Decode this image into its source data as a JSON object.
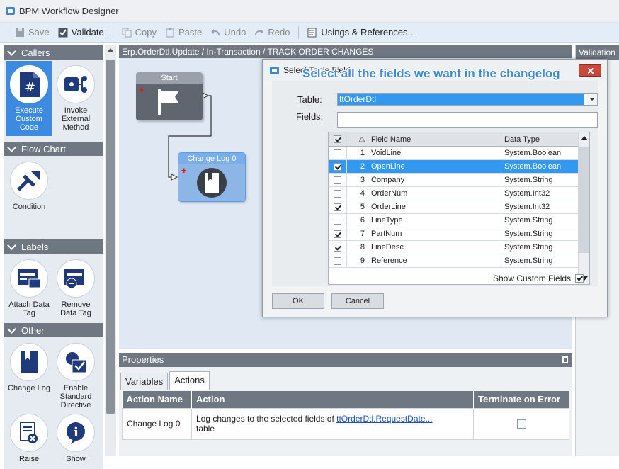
{
  "window": {
    "title": "BPM Workflow Designer",
    "icon": "app-icon"
  },
  "toolbar": {
    "items": [
      {
        "label": "Save",
        "icon": "save-icon",
        "enabled": false
      },
      {
        "label": "Validate",
        "icon": "validate-check-icon",
        "enabled": true
      },
      {
        "label": "Copy",
        "icon": "copy-icon",
        "enabled": false
      },
      {
        "label": "Paste",
        "icon": "paste-icon",
        "enabled": false
      },
      {
        "label": "Undo",
        "icon": "undo-icon",
        "enabled": false
      },
      {
        "label": "Redo",
        "icon": "redo-icon",
        "enabled": false
      },
      {
        "label": "Usings & References...",
        "icon": "usings-icon",
        "enabled": true
      }
    ]
  },
  "palette": {
    "categories": [
      {
        "name": "Callers",
        "tools": [
          {
            "label": "Execute Custom Code",
            "icon": "custom-code-icon",
            "selected": true
          },
          {
            "label": "Invoke External Method",
            "icon": "external-method-icon",
            "selected": false
          }
        ]
      },
      {
        "name": "Flow Chart",
        "tools": [
          {
            "label": "Condition",
            "icon": "condition-icon",
            "selected": false
          }
        ]
      },
      {
        "name": "Labels",
        "tools": [
          {
            "label": "Attach Data Tag",
            "icon": "attach-data-tag-icon",
            "selected": false
          },
          {
            "label": "Remove Data Tag",
            "icon": "remove-data-tag-icon",
            "selected": false
          }
        ]
      },
      {
        "name": "Other",
        "tools": [
          {
            "label": "Change Log",
            "icon": "change-log-icon",
            "selected": false
          },
          {
            "label": "Enable Standard Directive",
            "icon": "enable-directive-icon",
            "selected": false
          },
          {
            "label": "Raise",
            "icon": "raise-exception-icon",
            "selected": false
          },
          {
            "label": "Show",
            "icon": "show-message-icon",
            "selected": false
          }
        ]
      }
    ]
  },
  "canvas": {
    "title": "Erp.OrderDtl.Update / In-Transaction / TRACK ORDER CHANGES",
    "nodes": [
      {
        "title": "Start",
        "icon": "flag-icon"
      },
      {
        "title": "Change Log 0",
        "icon": "book-icon"
      }
    ]
  },
  "validation": {
    "title": "Validation"
  },
  "properties": {
    "title": "Properties",
    "tabs": [
      {
        "label": "Variables",
        "active": false
      },
      {
        "label": "Actions",
        "active": true
      }
    ],
    "columns": [
      "Action Name",
      "Action",
      "Terminate on Error"
    ],
    "rows": [
      {
        "name": "Change Log 0",
        "action_prefix": "Log changes to the selected fields of ",
        "action_link": "ttOrderDtl.RequestDate...",
        "action_suffix": "table",
        "terminate": false
      }
    ]
  },
  "dialog": {
    "title": "Select Table Fields",
    "callout": "Select all the fields we want in the changelog",
    "table_label": "Table:",
    "table_value": "ttOrderDtl",
    "fields_label": "Fields:",
    "fields_value": "",
    "grid_columns": [
      "Field Name",
      "Data Type"
    ],
    "grid_rows": [
      {
        "num": "1",
        "name": "VoidLine",
        "type": "System.Boolean",
        "checked": false,
        "selected": false
      },
      {
        "num": "2",
        "name": "OpenLine",
        "type": "System.Boolean",
        "checked": true,
        "selected": true
      },
      {
        "num": "3",
        "name": "Company",
        "type": "System.String",
        "checked": false,
        "selected": false
      },
      {
        "num": "4",
        "name": "OrderNum",
        "type": "System.Int32",
        "checked": false,
        "selected": false
      },
      {
        "num": "5",
        "name": "OrderLine",
        "type": "System.Int32",
        "checked": true,
        "selected": false
      },
      {
        "num": "6",
        "name": "LineType",
        "type": "System.String",
        "checked": false,
        "selected": false
      },
      {
        "num": "7",
        "name": "PartNum",
        "type": "System.String",
        "checked": true,
        "selected": false
      },
      {
        "num": "8",
        "name": "LineDesc",
        "type": "System.String",
        "checked": true,
        "selected": false
      },
      {
        "num": "9",
        "name": "Reference",
        "type": "System.String",
        "checked": false,
        "selected": false
      }
    ],
    "show_custom_label": "Show Custom Fields",
    "show_custom_checked": true,
    "ok_label": "OK",
    "cancel_label": "Cancel"
  },
  "colors": {
    "accent": "#3c8be0",
    "header": "#6f7782",
    "canvas": "#dfe8f3",
    "selection": "#3399f0"
  }
}
